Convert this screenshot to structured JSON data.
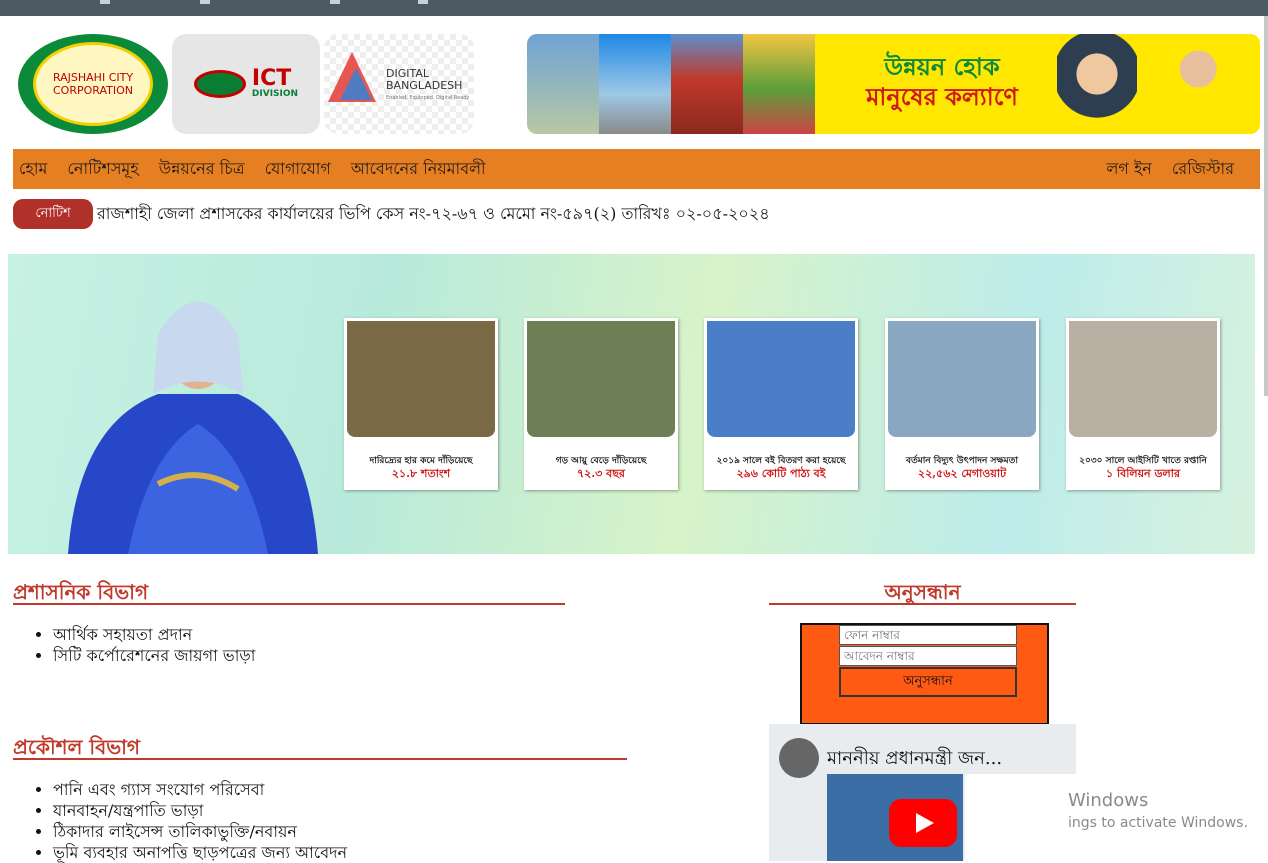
{
  "nav": {
    "left": [
      "হোম",
      "নোটিশসমূহ",
      "উন্নয়নের চিত্র",
      "যোগাযোগ",
      "আবেদনের নিয়মাবলী"
    ],
    "right": [
      "লগ ইন",
      "রেজিস্টার"
    ]
  },
  "logos": {
    "rcc_text": "RAJSHAHI CITY CORPORATION",
    "ict_main": "ICT",
    "ict_sub": "DIVISION",
    "db_main": "DIGITAL BANGLADESH",
    "db_sub": "Enabled, Equipped, Digital Ready"
  },
  "banner": {
    "line1": "উন্নয়ন হোক",
    "line2": "মানুষের কল্যাণে"
  },
  "ticker": {
    "badge": "নোটিশ",
    "text": "রাজশাহী জেলা প্রশাসকের কার্যালয়ের ভিপি কেস নং-৭২-৬৭ ও মেমো নং-৫৯৭(২) তারিখঃ ০২-০৫-২০২৪"
  },
  "hero_cards": [
    {
      "cap1": "দারিদ্র্যের হার কমে দাঁড়িয়েছে",
      "cap2": "২১.৮ শতাংশ",
      "color": "#7a6a45"
    },
    {
      "cap1": "গড় আয়ু বেড়ে দাঁড়িয়েছে",
      "cap2": "৭২.৩ বছর",
      "color": "#6e7f55"
    },
    {
      "cap1": "২০১৯ সালে বই বিতরণ করা হয়েছে",
      "cap2": "২৯৬ কোটি পাঠ্য বই",
      "color": "#4a7fc8"
    },
    {
      "cap1": "বর্তমান বিদ্যুৎ উৎপাদন সক্ষমতা",
      "cap2": "২২,৫৬২ মেগাওয়াট",
      "color": "#8aa7c2"
    },
    {
      "cap1": "২০৩০ সালে আইসিটি খাতে রপ্তানি",
      "cap2": "১ বিলিয়ন ডলার",
      "color": "#b9b0a4"
    }
  ],
  "sections": {
    "admin": {
      "title": "প্রশাসনিক বিভাগ",
      "items": [
        "আর্থিক সহায়তা প্রদান",
        "সিটি কর্পোরেশনের জায়গা ভাড়া"
      ]
    },
    "engineering": {
      "title": "প্রকৌশল বিভাগ",
      "items": [
        "পানি এবং গ্যাস সংযোগ পরিসেবা",
        "যানবাহন/যন্ত্রপাতি ভাড়া",
        "ঠিকাদার লাইসেন্স তালিকাভুক্তি/নবায়ন",
        "ভূমি ব্যবহার অনাপত্তি ছাড়পত্রের জন্য আবেদন"
      ]
    }
  },
  "search": {
    "title": "অনুসন্ধান",
    "phone_placeholder": "ফোন নাম্বার",
    "app_placeholder": "আবেদন নাম্বার",
    "button": "অনুসন্ধান"
  },
  "video": {
    "title": "মাননীয় প্রধানমন্ত্রী জন..."
  },
  "watermark": {
    "line1": "Windows",
    "line2": "ings to activate Windows."
  },
  "colors": {
    "nav": "#e67e22",
    "accent_red": "#c0392b",
    "search_bg": "#ff5a14",
    "badge": "#b0302a"
  }
}
